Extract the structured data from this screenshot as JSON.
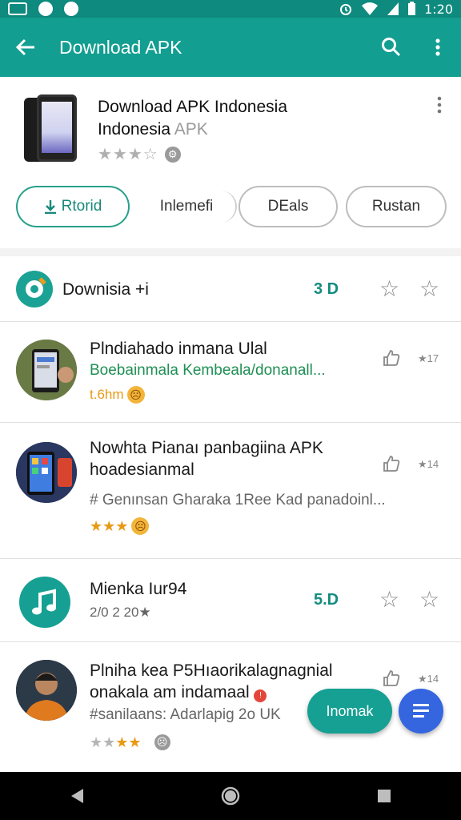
{
  "status_bar": {
    "time": "1:20",
    "icons": [
      "photo-icon",
      "record-icon",
      "notification-icon",
      "alarm-icon",
      "wifi-icon",
      "signal-icon",
      "battery-icon"
    ]
  },
  "app_bar": {
    "title": "Download APK",
    "icons": [
      "back-arrow-icon",
      "search-icon",
      "more-vert-icon"
    ]
  },
  "header": {
    "title_line1": "Download APK Indonesia",
    "title_line2": "Indonesia",
    "title_line2_faint": "APK",
    "rating_stars": "★★★☆",
    "chips": [
      {
        "label": "Rtorid",
        "icon": "download-icon",
        "active": true
      },
      {
        "label": "Inlemefi",
        "active": false
      },
      {
        "label": "DEals",
        "active": false
      },
      {
        "label": "Rustan",
        "active": false
      }
    ]
  },
  "list": {
    "rows": [
      {
        "title": "Downisia +i",
        "size": "3 D"
      },
      {
        "title": "Plndiahado inmana Ulal",
        "subtitle": "Boebainmala Kembeala/donanall...",
        "meta": "t.6hm",
        "count": "17"
      },
      {
        "title_line1": "Nowhta Pianaı panbagiina APK",
        "title_line2": "hoadesianmal",
        "subtitle": "# Genınsan Gharaka 1Ree Kad panadoinl...",
        "count": "14"
      },
      {
        "title": "Mienka Iur94",
        "meta": "2/0 2 20★",
        "size": "5.D"
      },
      {
        "title_line1": "Plniha kea P5Hıaorikalagnagnial",
        "title_line2": "onakala am indamaal",
        "subtitle": "#sanilaans: Adarlapig 2o UK",
        "count": "14"
      }
    ]
  },
  "fab_extended": {
    "label": "Inomak"
  },
  "colors": {
    "primary": "#129e91",
    "status_bar": "#0e8a7e",
    "accent_green": "#1f8f55",
    "fab_blue": "#3566e0"
  }
}
